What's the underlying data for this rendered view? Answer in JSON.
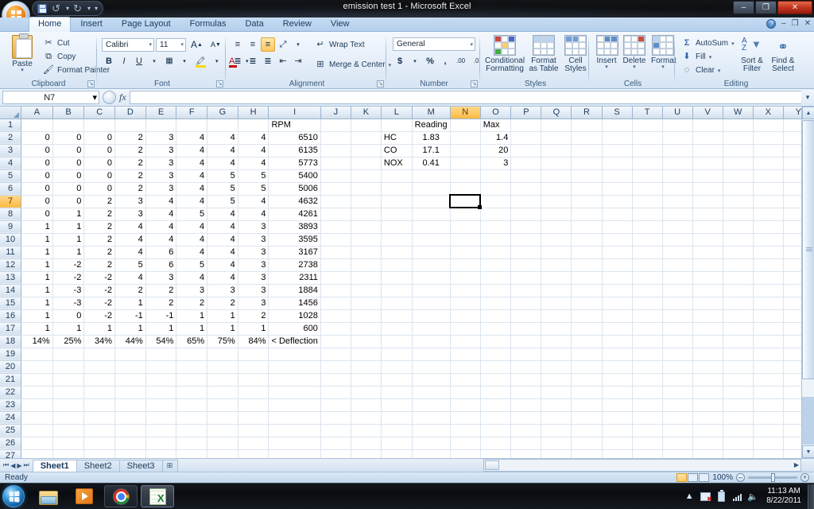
{
  "window": {
    "title": "emission test 1 - Microsoft Excel",
    "minimize": "–",
    "maximize": "❐",
    "close": "✕"
  },
  "quick_access": {
    "save": "save-icon",
    "undo": "↺",
    "redo": "↻",
    "customize": "▾"
  },
  "ribbon": {
    "tabs": [
      {
        "label": "Home",
        "active": true
      },
      {
        "label": "Insert",
        "active": false
      },
      {
        "label": "Page Layout",
        "active": false
      },
      {
        "label": "Formulas",
        "active": false
      },
      {
        "label": "Data",
        "active": false
      },
      {
        "label": "Review",
        "active": false
      },
      {
        "label": "View",
        "active": false
      }
    ],
    "help": "?",
    "min_ribbon": "–",
    "restore_ribbon": "❐",
    "close_ribbon": "✕",
    "groups": {
      "clipboard": {
        "label": "Clipboard",
        "paste": "Paste",
        "cut": "Cut",
        "copy": "Copy",
        "format_painter": "Format Painter"
      },
      "font": {
        "label": "Font",
        "font_name": "Calibri",
        "font_size": "11",
        "grow": "A",
        "shrink": "A",
        "bold": "B",
        "italic": "I",
        "underline": "U",
        "borders": "▦",
        "fill_color": "A",
        "font_color": "A"
      },
      "alignment": {
        "label": "Alignment",
        "wrap_text": "Wrap Text",
        "merge_center": "Merge & Center",
        "align_top": "≡",
        "align_middle": "≡",
        "align_bottom": "≡",
        "orientation": "⤡",
        "align_left": "≡",
        "align_center": "≡",
        "align_right": "≡",
        "decrease_indent": "⇤",
        "increase_indent": "⇥"
      },
      "number": {
        "label": "Number",
        "format": "General",
        "currency": "$",
        "percent": "%",
        "comma": ",",
        "increase_decimal": ".00",
        "decrease_decimal": ".0"
      },
      "styles": {
        "label": "Styles",
        "conditional_formatting": "Conditional\nFormatting",
        "conditional_formatting_l1": "Conditional",
        "conditional_formatting_l2": "Formatting",
        "format_as_table_l1": "Format",
        "format_as_table_l2": "as Table",
        "cell_styles_l1": "Cell",
        "cell_styles_l2": "Styles"
      },
      "cells": {
        "label": "Cells",
        "insert": "Insert",
        "delete": "Delete",
        "format": "Format"
      },
      "editing": {
        "label": "Editing",
        "autosum": "AutoSum",
        "fill": "Fill",
        "clear": "Clear",
        "sort_filter_l1": "Sort &",
        "sort_filter_l2": "Filter",
        "find_select_l1": "Find &",
        "find_select_l2": "Select"
      }
    }
  },
  "formula_bar": {
    "name_box": "N7",
    "name_box_caret": "▾",
    "fx": "fx",
    "formula": "",
    "expand": "▾"
  },
  "grid": {
    "columns": [
      "A",
      "B",
      "C",
      "D",
      "E",
      "F",
      "G",
      "H",
      "I",
      "J",
      "K",
      "L",
      "M",
      "N",
      "O",
      "P",
      "Q",
      "R",
      "S",
      "T",
      "U",
      "V",
      "W",
      "X",
      "Y"
    ],
    "selected_column": "N",
    "selected_row": 7,
    "active_cell": "N7",
    "rows": [
      1,
      2,
      3,
      4,
      5,
      6,
      7,
      8,
      9,
      10,
      11,
      12,
      13,
      14,
      15,
      16,
      17,
      18,
      19,
      20,
      21,
      22,
      23,
      24,
      25,
      26,
      27
    ],
    "data": [
      {
        "row": 1,
        "I": "RPM",
        "M": "Reading",
        "O": "Max"
      },
      {
        "row": 2,
        "A": "0",
        "B": "0",
        "C": "0",
        "D": "2",
        "E": "3",
        "F": "4",
        "G": "4",
        "H": "4",
        "I": "6510",
        "L": "HC",
        "M": "1.83",
        "O": "1.4"
      },
      {
        "row": 3,
        "A": "0",
        "B": "0",
        "C": "0",
        "D": "2",
        "E": "3",
        "F": "4",
        "G": "4",
        "H": "4",
        "I": "6135",
        "L": "CO",
        "M": "17.1",
        "O": "20"
      },
      {
        "row": 4,
        "A": "0",
        "B": "0",
        "C": "0",
        "D": "2",
        "E": "3",
        "F": "4",
        "G": "4",
        "H": "4",
        "I": "5773",
        "L": "NOX",
        "M": "0.41",
        "O": "3"
      },
      {
        "row": 5,
        "A": "0",
        "B": "0",
        "C": "0",
        "D": "2",
        "E": "3",
        "F": "4",
        "G": "5",
        "H": "5",
        "I": "5400"
      },
      {
        "row": 6,
        "A": "0",
        "B": "0",
        "C": "0",
        "D": "2",
        "E": "3",
        "F": "4",
        "G": "5",
        "H": "5",
        "I": "5006"
      },
      {
        "row": 7,
        "A": "0",
        "B": "0",
        "C": "2",
        "D": "3",
        "E": "4",
        "F": "4",
        "G": "5",
        "H": "4",
        "I": "4632"
      },
      {
        "row": 8,
        "A": "0",
        "B": "1",
        "C": "2",
        "D": "3",
        "E": "4",
        "F": "5",
        "G": "4",
        "H": "4",
        "I": "4261"
      },
      {
        "row": 9,
        "A": "1",
        "B": "1",
        "C": "2",
        "D": "4",
        "E": "4",
        "F": "4",
        "G": "4",
        "H": "3",
        "I": "3893"
      },
      {
        "row": 10,
        "A": "1",
        "B": "1",
        "C": "2",
        "D": "4",
        "E": "4",
        "F": "4",
        "G": "4",
        "H": "3",
        "I": "3595"
      },
      {
        "row": 11,
        "A": "1",
        "B": "1",
        "C": "2",
        "D": "4",
        "E": "6",
        "F": "4",
        "G": "4",
        "H": "3",
        "I": "3167"
      },
      {
        "row": 12,
        "A": "1",
        "B": "-2",
        "C": "2",
        "D": "5",
        "E": "6",
        "F": "5",
        "G": "4",
        "H": "3",
        "I": "2738"
      },
      {
        "row": 13,
        "A": "1",
        "B": "-2",
        "C": "-2",
        "D": "4",
        "E": "3",
        "F": "4",
        "G": "4",
        "H": "3",
        "I": "2311"
      },
      {
        "row": 14,
        "A": "1",
        "B": "-3",
        "C": "-2",
        "D": "2",
        "E": "2",
        "F": "3",
        "G": "3",
        "H": "3",
        "I": "1884"
      },
      {
        "row": 15,
        "A": "1",
        "B": "-3",
        "C": "-2",
        "D": "1",
        "E": "2",
        "F": "2",
        "G": "2",
        "H": "3",
        "I": "1456"
      },
      {
        "row": 16,
        "A": "1",
        "B": "0",
        "C": "-2",
        "D": "-1",
        "E": "-1",
        "F": "1",
        "G": "1",
        "H": "2",
        "I": "1028"
      },
      {
        "row": 17,
        "A": "1",
        "B": "1",
        "C": "1",
        "D": "1",
        "E": "1",
        "F": "1",
        "G": "1",
        "H": "1",
        "I": "600"
      },
      {
        "row": 18,
        "A": "14%",
        "B": "25%",
        "C": "34%",
        "D": "44%",
        "E": "54%",
        "F": "65%",
        "G": "75%",
        "H": "84%",
        "I": "< Deflection"
      }
    ]
  },
  "sheet_tabs": {
    "first": "⏮",
    "prev": "◀",
    "next": "▶",
    "last": "⏭",
    "tabs": [
      {
        "label": "Sheet1",
        "active": true
      },
      {
        "label": "Sheet2",
        "active": false
      },
      {
        "label": "Sheet3",
        "active": false
      }
    ],
    "insert_sheet": "insert-worksheet-icon"
  },
  "status_bar": {
    "mode": "Ready",
    "view_normal": "normal-view-icon",
    "view_page_layout": "page-layout-view-icon",
    "view_page_break": "page-break-view-icon",
    "zoom": "100%",
    "zoom_out": "–",
    "zoom_in": "+"
  },
  "taskbar": {
    "start": "start-orb",
    "items": [
      {
        "name": "windows-explorer",
        "icon": "folder-icon"
      },
      {
        "name": "windows-media-player",
        "icon": "media-player-icon"
      },
      {
        "name": "google-chrome",
        "icon": "chrome-icon"
      },
      {
        "name": "microsoft-excel",
        "icon": "excel-icon"
      }
    ],
    "tray": {
      "show_hidden": "▲",
      "network": "network-icon",
      "battery": "battery-icon",
      "volume": "🔊",
      "time": "11:13 AM",
      "date": "8/22/2011"
    }
  },
  "colors": {
    "rpm_header": "#3fb6e8",
    "rpm_values": "#ff0000",
    "deflection": "#2ea14c",
    "deflection_label": "#3fb6e8",
    "selection": "#ffb943"
  }
}
